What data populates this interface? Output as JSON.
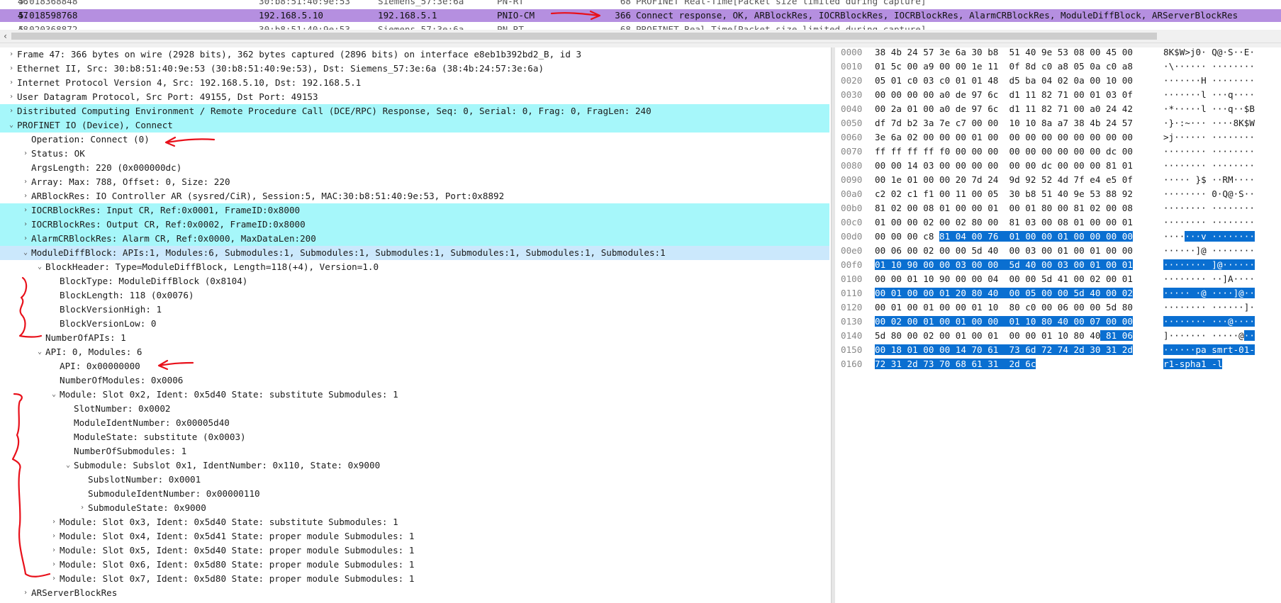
{
  "packet_list": {
    "rows": [
      {
        "no": "46",
        "time": "5.018368848",
        "source": "30:b8:51:40:9e:53",
        "destination": "Siemens_57:3e:6a",
        "protocol": "PN-RT",
        "length": "68",
        "info": "PROFINET Real-Time[Packet size limited during capture]"
      },
      {
        "no": "47",
        "time": "5.018598768",
        "source": "192.168.5.10",
        "destination": "192.168.5.1",
        "protocol": "PNIO-CM",
        "length": "366",
        "info": "Connect response, OK, ARBlockRes, IOCRBlockRes, IOCRBlockRes, AlarmCRBlockRes, ModuleDiffBlock, ARServerBlockRes"
      },
      {
        "no": "48",
        "time": "5.020368872",
        "source": "30:b8:51:40:9e:53",
        "destination": "Siemens_57:3e:6a",
        "protocol": "PN-RT",
        "length": "68",
        "info": "PROFINET Real-Time[Packet size limited during capture]"
      }
    ]
  },
  "details": {
    "rows": [
      {
        "text": "Frame 47: 366 bytes on wire (2928 bits), 362 bytes captured (2896 bits) on interface e8eb1b392bd2_B, id 3",
        "expander": "›",
        "style": "",
        "indent": 0
      },
      {
        "text": "Ethernet II, Src: 30:b8:51:40:9e:53 (30:b8:51:40:9e:53), Dst: Siemens_57:3e:6a (38:4b:24:57:3e:6a)",
        "expander": "›",
        "style": "",
        "indent": 0
      },
      {
        "text": "Internet Protocol Version 4, Src: 192.168.5.10, Dst: 192.168.5.1",
        "expander": "›",
        "style": "",
        "indent": 0
      },
      {
        "text": "User Datagram Protocol, Src Port: 49155, Dst Port: 49153",
        "expander": "›",
        "style": "",
        "indent": 0
      },
      {
        "text": "Distributed Computing Environment / Remote Procedure Call (DCE/RPC) Response, Seq: 0, Serial: 0, Frag: 0, FragLen: 240",
        "expander": "›",
        "style": "hl",
        "indent": 0
      },
      {
        "text": "PROFINET IO (Device), Connect",
        "expander": "⌄",
        "style": "hl",
        "indent": 0
      },
      {
        "text": "Operation: Connect (0)",
        "expander": "",
        "style": "",
        "indent": 1
      },
      {
        "text": "Status: OK",
        "expander": "›",
        "style": "",
        "indent": 1
      },
      {
        "text": "ArgsLength: 220 (0x000000dc)",
        "expander": "",
        "style": "",
        "indent": 1
      },
      {
        "text": "Array: Max: 788, Offset: 0, Size: 220",
        "expander": "›",
        "style": "",
        "indent": 1
      },
      {
        "text": "ARBlockRes: IO Controller AR (sysred/CiR), Session:5, MAC:30:b8:51:40:9e:53, Port:0x8892",
        "expander": "›",
        "style": "",
        "indent": 1
      },
      {
        "text": "IOCRBlockRes: Input CR, Ref:0x0001, FrameID:0x8000",
        "expander": "›",
        "style": "hl",
        "indent": 1
      },
      {
        "text": "IOCRBlockRes: Output CR, Ref:0x0002, FrameID:0x8000",
        "expander": "›",
        "style": "hl",
        "indent": 1
      },
      {
        "text": "AlarmCRBlockRes: Alarm CR, Ref:0x0000, MaxDataLen:200",
        "expander": "›",
        "style": "hl",
        "indent": 1
      },
      {
        "text": "ModuleDiffBlock: APIs:1, Modules:6, Submodules:1, Submodules:1, Submodules:1, Submodules:1, Submodules:1, Submodules:1",
        "expander": "⌄",
        "style": "sel",
        "indent": 1
      },
      {
        "text": "BlockHeader: Type=ModuleDiffBlock, Length=118(+4), Version=1.0",
        "expander": "⌄",
        "style": "",
        "indent": 2
      },
      {
        "text": "BlockType: ModuleDiffBlock (0x8104)",
        "expander": "",
        "style": "",
        "indent": 3
      },
      {
        "text": "BlockLength: 118 (0x0076)",
        "expander": "",
        "style": "",
        "indent": 3
      },
      {
        "text": "BlockVersionHigh: 1",
        "expander": "",
        "style": "",
        "indent": 3
      },
      {
        "text": "BlockVersionLow: 0",
        "expander": "",
        "style": "",
        "indent": 3
      },
      {
        "text": "NumberOfAPIs: 1",
        "expander": "",
        "style": "",
        "indent": 2
      },
      {
        "text": "API: 0, Modules: 6",
        "expander": "⌄",
        "style": "",
        "indent": 2
      },
      {
        "text": "API: 0x00000000",
        "expander": "",
        "style": "",
        "indent": 3
      },
      {
        "text": "NumberOfModules: 0x0006",
        "expander": "",
        "style": "",
        "indent": 3
      },
      {
        "text": "Module: Slot 0x2, Ident: 0x5d40 State: substitute Submodules: 1",
        "expander": "⌄",
        "style": "",
        "indent": 3
      },
      {
        "text": "SlotNumber: 0x0002",
        "expander": "",
        "style": "",
        "indent": 4
      },
      {
        "text": "ModuleIdentNumber: 0x00005d40",
        "expander": "",
        "style": "",
        "indent": 4
      },
      {
        "text": "ModuleState: substitute (0x0003)",
        "expander": "",
        "style": "",
        "indent": 4
      },
      {
        "text": "NumberOfSubmodules: 1",
        "expander": "",
        "style": "",
        "indent": 4
      },
      {
        "text": "Submodule: Subslot 0x1, IdentNumber: 0x110, State: 0x9000",
        "expander": "⌄",
        "style": "",
        "indent": 4
      },
      {
        "text": "SubslotNumber: 0x0001",
        "expander": "",
        "style": "",
        "indent": 5
      },
      {
        "text": "SubmoduleIdentNumber: 0x00000110",
        "expander": "",
        "style": "",
        "indent": 5
      },
      {
        "text": "SubmoduleState: 0x9000",
        "expander": "›",
        "style": "",
        "indent": 5
      },
      {
        "text": "Module: Slot 0x3, Ident: 0x5d40 State: substitute Submodules: 1",
        "expander": "›",
        "style": "",
        "indent": 3
      },
      {
        "text": "Module: Slot 0x4, Ident: 0x5d41 State: proper module Submodules: 1",
        "expander": "›",
        "style": "",
        "indent": 3
      },
      {
        "text": "Module: Slot 0x5, Ident: 0x5d40 State: proper module Submodules: 1",
        "expander": "›",
        "style": "",
        "indent": 3
      },
      {
        "text": "Module: Slot 0x6, Ident: 0x5d80 State: proper module Submodules: 1",
        "expander": "›",
        "style": "",
        "indent": 3
      },
      {
        "text": "Module: Slot 0x7, Ident: 0x5d80 State: proper module Submodules: 1",
        "expander": "›",
        "style": "",
        "indent": 3
      },
      {
        "text": "ARServerBlockRes",
        "expander": "›",
        "style": "",
        "indent": 1
      }
    ]
  },
  "bytes": {
    "rows": [
      {
        "offset": "0000",
        "hex": "38 4b 24 57 3e 6a 30 b8  51 40 9e 53 08 00 45 00",
        "ascii": "8K$W>j0· Q@·S··E·"
      },
      {
        "offset": "0010",
        "hex": "01 5c 00 a9 00 00 1e 11  0f 8d c0 a8 05 0a c0 a8",
        "ascii": "·\\······ ········"
      },
      {
        "offset": "0020",
        "hex": "05 01 c0 03 c0 01 01 48  d5 ba 04 02 0a 00 10 00",
        "ascii": "·······H ········"
      },
      {
        "offset": "0030",
        "hex": "00 00 00 00 a0 de 97 6c  d1 11 82 71 00 01 03 0f",
        "ascii": "·······l ···q····"
      },
      {
        "offset": "0040",
        "hex": "00 2a 01 00 a0 de 97 6c  d1 11 82 71 00 a0 24 42",
        "ascii": "·*·····l ···q··$B"
      },
      {
        "offset": "0050",
        "hex": "df 7d b2 3a 7e c7 00 00  10 10 8a a7 38 4b 24 57",
        "ascii": "·}·:~··· ····8K$W"
      },
      {
        "offset": "0060",
        "hex": "3e 6a 02 00 00 00 01 00  00 00 00 00 00 00 00 00",
        "ascii": ">j······ ········"
      },
      {
        "offset": "0070",
        "hex": "ff ff ff ff f0 00 00 00  00 00 00 00 00 00 dc 00",
        "ascii": "········ ········"
      },
      {
        "offset": "0080",
        "hex": "00 00 14 03 00 00 00 00  00 00 dc 00 00 00 81 01",
        "ascii": "········ ········"
      },
      {
        "offset": "0090",
        "hex": "00 1e 01 00 00 20 7d 24  9d 92 52 4d 7f e4 e5 0f",
        "ascii": "····· }$ ··RM····"
      },
      {
        "offset": "00a0",
        "hex": "c2 02 c1 f1 00 11 00 05  30 b8 51 40 9e 53 88 92",
        "ascii": "········ 0·Q@·S··"
      },
      {
        "offset": "00b0",
        "hex": "81 02 00 08 01 00 00 01  00 01 80 00 81 02 00 08",
        "ascii": "········ ········"
      },
      {
        "offset": "00c0",
        "hex": "01 00 00 02 00 02 80 00  81 03 00 08 01 00 00 01",
        "ascii": "········ ········"
      },
      {
        "offset": "00d0",
        "hex": "00 00 00 c8 |81 04 00 76  01 00 00 01 00 00 00 00",
        "ascii": "····|···v ········"
      },
      {
        "offset": "00e0",
        "hex": "|00 06 00 02 00 00 5d 40  00 03 00 01 00 01 00 00",
        "ascii": "|······]@ ········"
      },
      {
        "offset": "00f0",
        "hex": "|01 10 90 00 00 03 00 00  5d 40 00 03 00 01 00 01",
        "ascii": "|········ ]@······"
      },
      {
        "offset": "0100",
        "hex": "|00 00 01 10 90 00 00 04  00 00 5d 41 00 02 00 01",
        "ascii": "|········ ··]A····"
      },
      {
        "offset": "0110",
        "hex": "|00 01 00 00 01 20 80 40  00 05 00 00 5d 40 00 02",
        "ascii": "|····· ·@ ····]@··"
      },
      {
        "offset": "0120",
        "hex": "|00 01 00 01 00 00 01 10  80 c0 00 06 00 00 5d 80",
        "ascii": "|········ ······]·"
      },
      {
        "offset": "0130",
        "hex": "|00 02 00 01 00 01 00 00  01 10 80 40 00 07 00 00",
        "ascii": "|········ ···@····"
      },
      {
        "offset": "0140",
        "hex": "|5d 80 00 02 00 01 00 01  00 00 01 10 80 40| 81 06",
        "ascii": "|]······· ·····@|··"
      },
      {
        "offset": "0150",
        "hex": "00 18 01 00 00 14 70 61  73 6d 72 74 2d 30 31 2d",
        "ascii": "······pa smrt-01-"
      },
      {
        "offset": "0160",
        "hex": "72 31 2d 73 70 68 61 31  2d 6c",
        "ascii": "r1-spha1 -l"
      }
    ]
  },
  "colors": {
    "selected_packet": "#b58fe0",
    "highlight_cyan": "#a6f7fa",
    "selected_tree": "#cbe8fc",
    "byte_highlight": "#0a6fd1",
    "annotation_red": "#e8101a"
  },
  "icons": {
    "expand": "chevron-right-icon",
    "collapse": "chevron-down-icon",
    "scroll_left": "arrow-left-icon"
  }
}
